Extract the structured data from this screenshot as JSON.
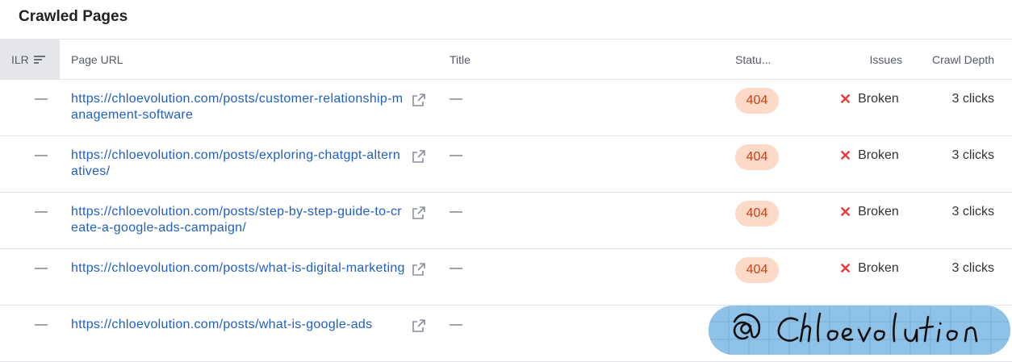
{
  "title": "Crawled Pages",
  "columns": {
    "ilr": "ILR",
    "url": "Page URL",
    "title": "Title",
    "status": "Statu...",
    "issues": "Issues",
    "depth": "Crawl Depth"
  },
  "rows": [
    {
      "ilr": "—",
      "url": "https://chloevolution.com/posts/customer-relationship-management-software",
      "title": "—",
      "status": "404",
      "issue": "Broken",
      "depth": "3 clicks"
    },
    {
      "ilr": "—",
      "url": "https://chloevolution.com/posts/exploring-chatgpt-alternatives/",
      "title": "—",
      "status": "404",
      "issue": "Broken",
      "depth": "3 clicks"
    },
    {
      "ilr": "—",
      "url": "https://chloevolution.com/posts/step-by-step-guide-to-create-a-google-ads-campaign/",
      "title": "—",
      "status": "404",
      "issue": "Broken",
      "depth": "3 clicks"
    },
    {
      "ilr": "—",
      "url": "https://chloevolution.com/posts/what-is-digital-marketing",
      "title": "—",
      "status": "404",
      "issue": "Broken",
      "depth": "3 clicks"
    },
    {
      "ilr": "—",
      "url": "https://chloevolution.com/posts/what-is-google-ads",
      "title": "—",
      "status": "",
      "issue": "",
      "depth": ""
    }
  ],
  "watermark_text": "@ Chloevolution",
  "colors": {
    "link": "#1f5fc4",
    "badge_bg": "#fdd9c8",
    "badge_text": "#c4421a",
    "issue_x": "#e83a3a"
  }
}
